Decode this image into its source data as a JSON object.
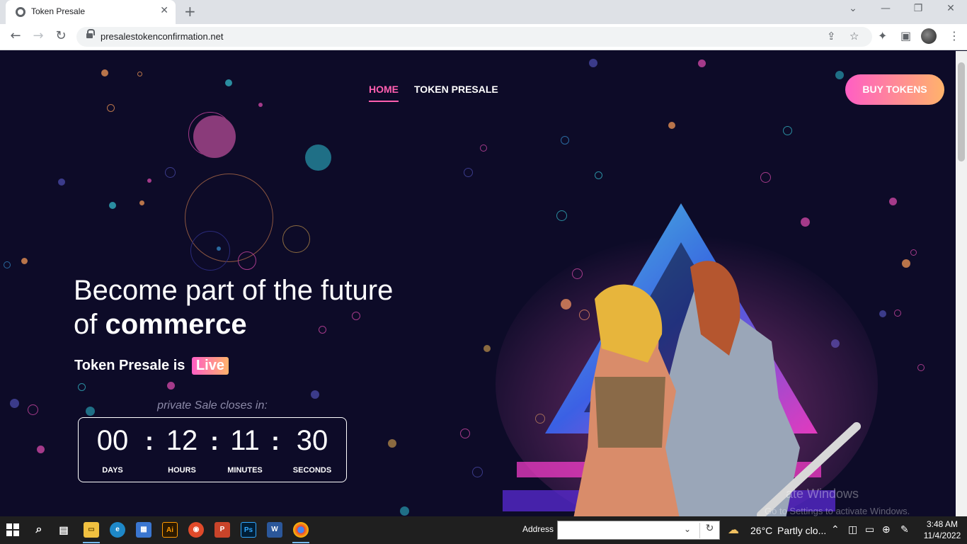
{
  "browser": {
    "tab_title": "Token Presale",
    "url": "presalestokenconfirmation.net"
  },
  "nav": {
    "home": "HOME",
    "token_presale": "TOKEN PRESALE",
    "buy_tokens": "BUY TOKENS"
  },
  "hero": {
    "headline_line1": "Become part of the future",
    "headline_of": "of",
    "headline_bold": "commerce",
    "presale_text": "Token Presale is",
    "live_badge": "Live",
    "closes_in": "private Sale closes in:"
  },
  "countdown": {
    "days": "00",
    "hours": "12",
    "minutes": "11",
    "seconds": "30",
    "days_label": "DAYS",
    "hours_label": "HOURS",
    "minutes_label": "MINUTES",
    "seconds_label": "SECONDS",
    "separator": ":"
  },
  "watermark": {
    "line1": "ate Windows",
    "line2": "Go to Settings to activate Windows."
  },
  "taskbar": {
    "address_label": "Address",
    "weather_temp": "26°C",
    "weather_text": "Partly clo...",
    "time": "3:48 AM",
    "date": "11/4/2022"
  },
  "colors": {
    "page_bg": "#0d0b28",
    "accent_pink": "#ff5fb0",
    "accent_orange": "#ffb36b"
  }
}
